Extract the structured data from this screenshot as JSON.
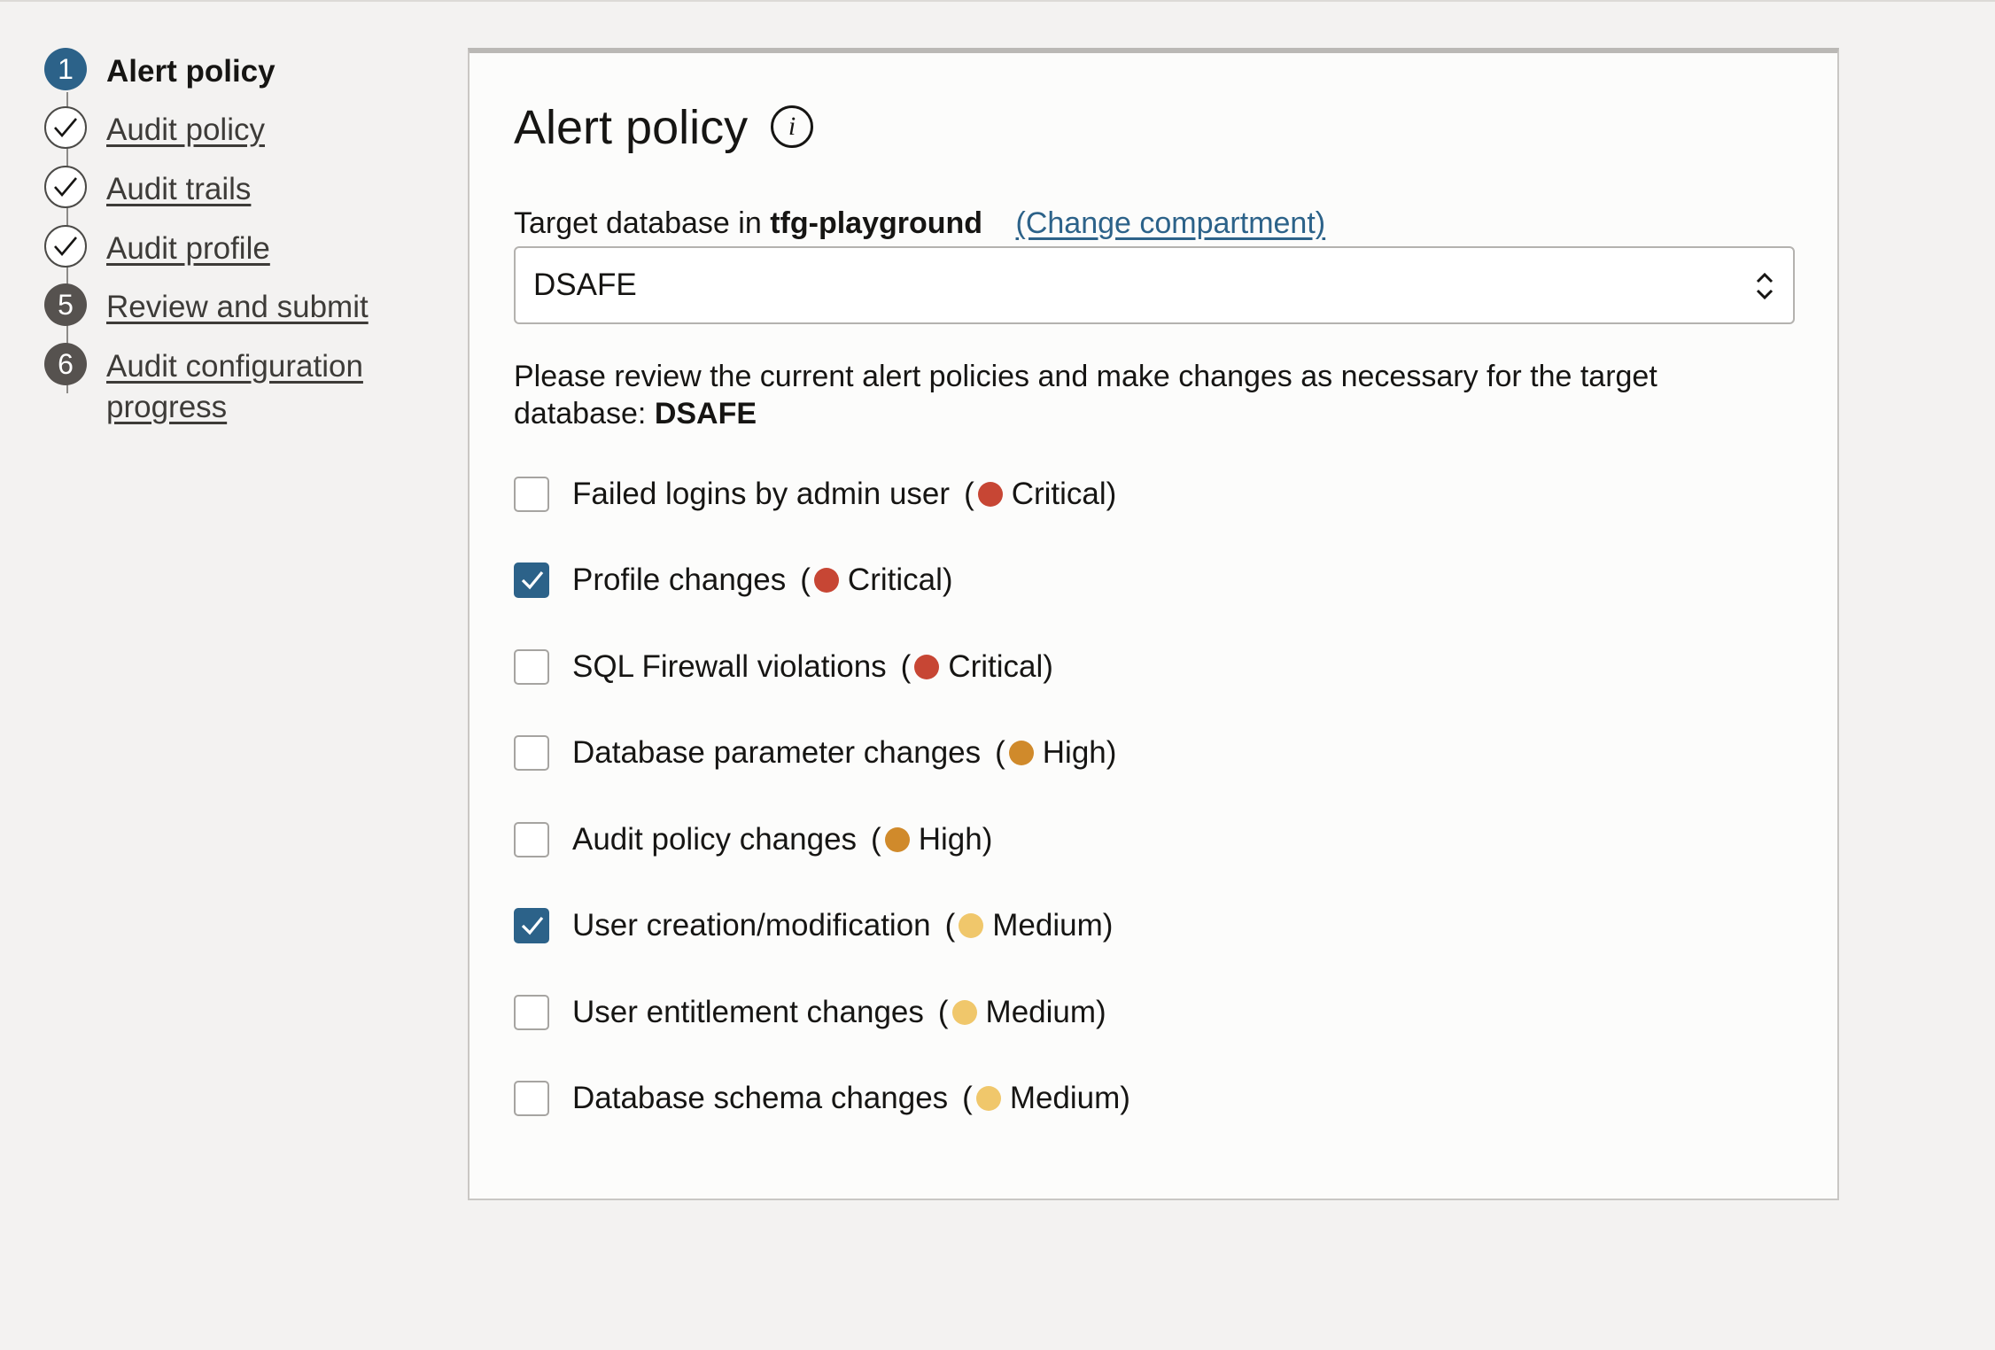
{
  "steps": [
    {
      "num": "1",
      "label": "Alert policy",
      "state": "current"
    },
    {
      "num": "",
      "label": "Audit policy",
      "state": "done"
    },
    {
      "num": "",
      "label": "Audit trails",
      "state": "done"
    },
    {
      "num": "",
      "label": "Audit profile",
      "state": "done"
    },
    {
      "num": "5",
      "label": "Review and submit",
      "state": "todo"
    },
    {
      "num": "6",
      "label": "Audit configuration progress",
      "state": "todo"
    }
  ],
  "card": {
    "title": "Alert policy",
    "info_glyph": "i",
    "target_prefix": "Target database in",
    "compartment": "tfg-playground",
    "change_link": "(Change compartment)",
    "selected_db": "DSAFE",
    "desc_text": "Please review the current alert policies and make changes as necessary for the target database:",
    "desc_db": "DSAFE"
  },
  "severity_colors": {
    "Critical": "#c74634",
    "High": "#d08a2b",
    "Medium": "#f0c76b"
  },
  "policies": [
    {
      "name": "Failed logins by admin user",
      "checked": false,
      "severity": "Critical"
    },
    {
      "name": "Profile changes",
      "checked": true,
      "severity": "Critical"
    },
    {
      "name": "SQL Firewall violations",
      "checked": false,
      "severity": "Critical"
    },
    {
      "name": "Database parameter changes",
      "checked": false,
      "severity": "High"
    },
    {
      "name": "Audit policy changes",
      "checked": false,
      "severity": "High"
    },
    {
      "name": "User creation/modification",
      "checked": true,
      "severity": "Medium"
    },
    {
      "name": "User entitlement changes",
      "checked": false,
      "severity": "Medium"
    },
    {
      "name": "Database schema changes",
      "checked": false,
      "severity": "Medium"
    }
  ]
}
